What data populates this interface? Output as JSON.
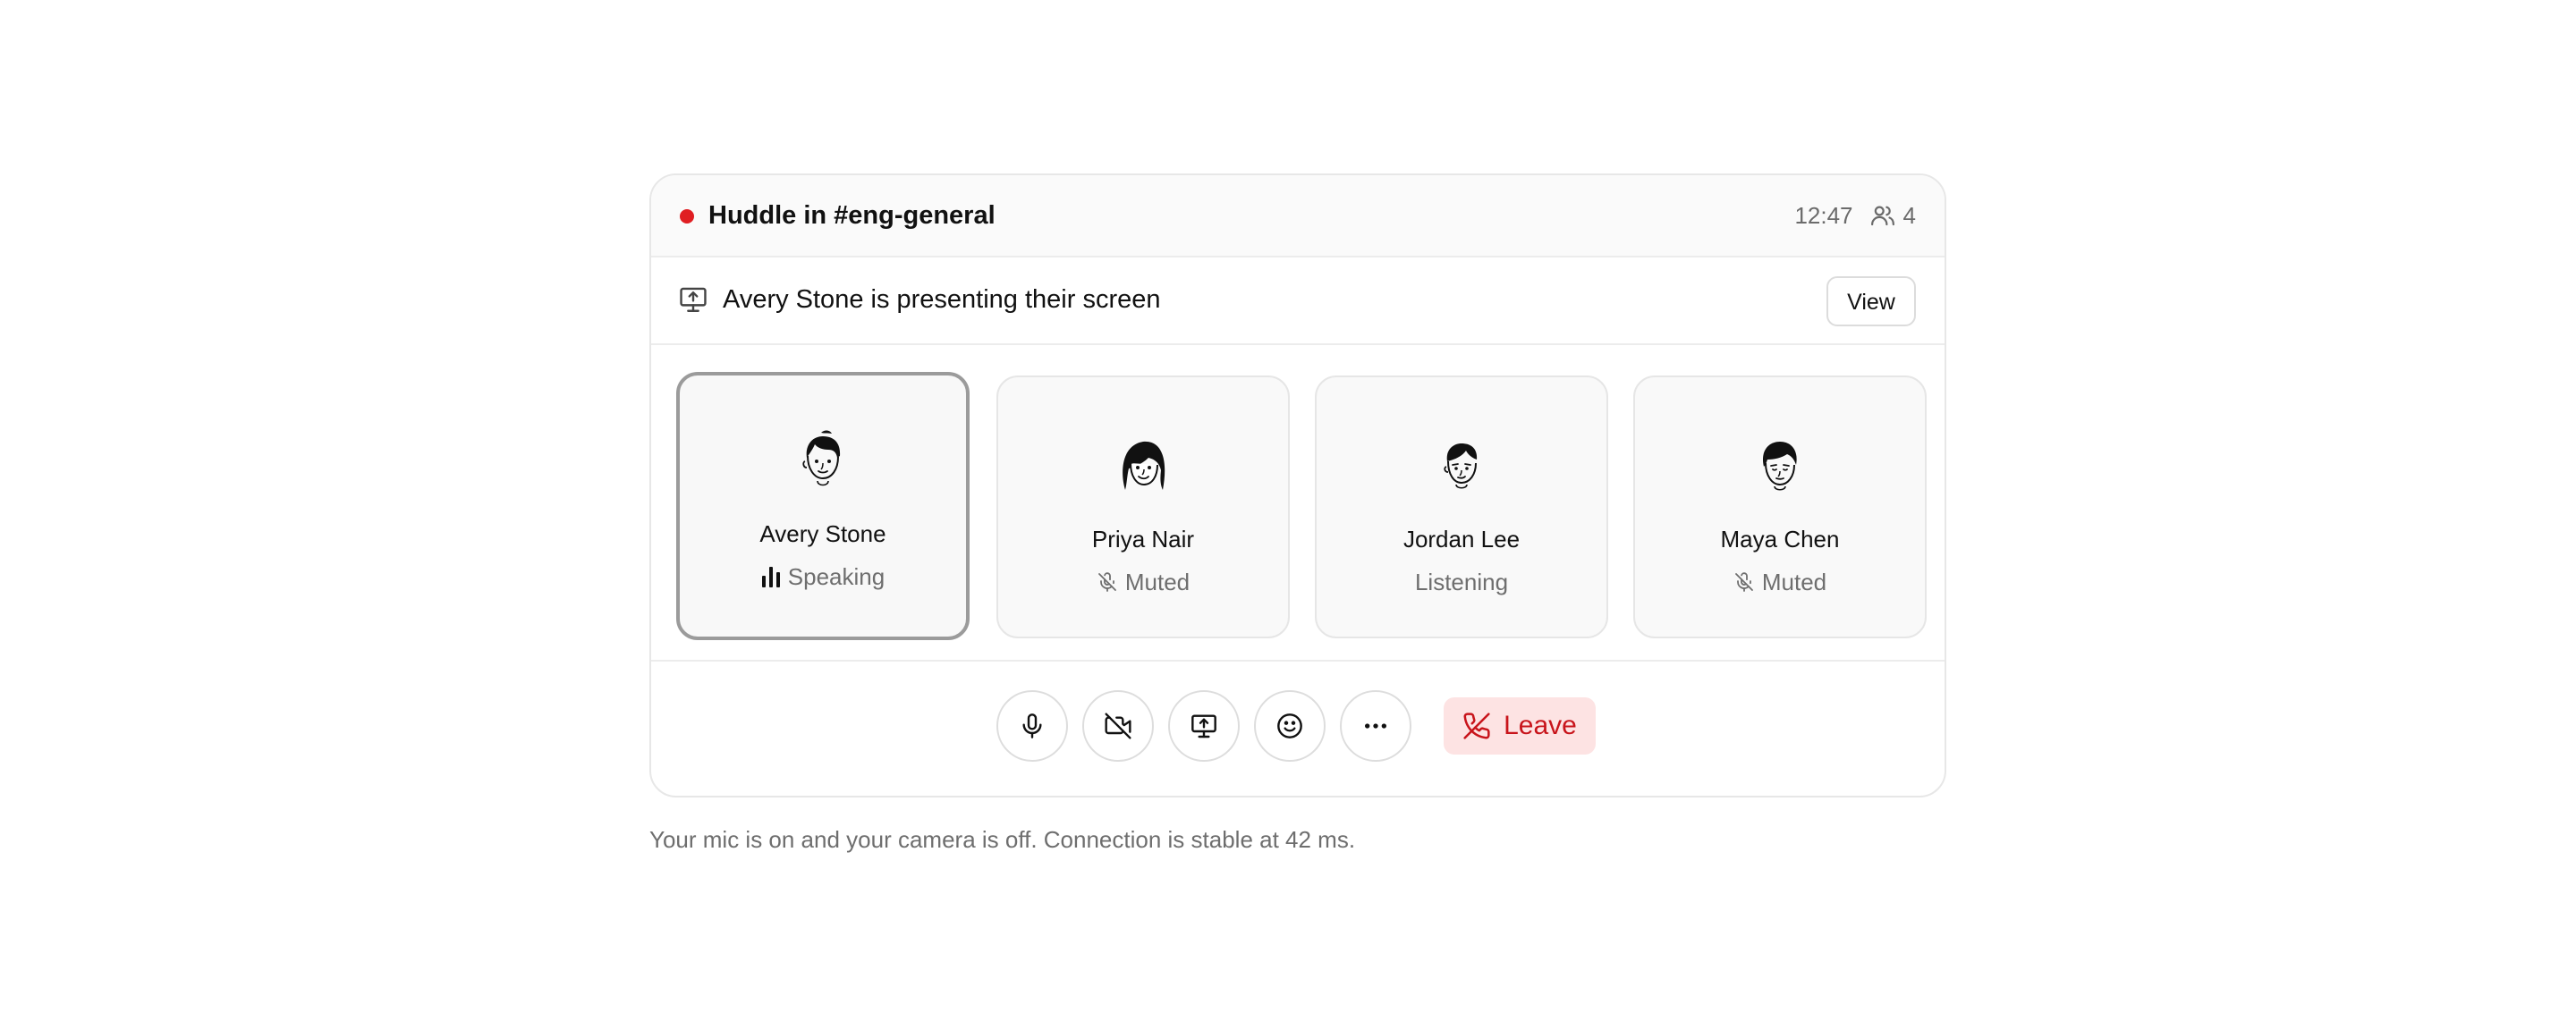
{
  "huddle": {
    "title": "Huddle in #eng-general",
    "elapsed": "12:47",
    "participant_count": "4",
    "live_color": "#e01e22"
  },
  "presenting": {
    "text": "Avery Stone is presenting their screen",
    "view_label": "View",
    "icon": "screen-share-icon"
  },
  "participants": [
    {
      "name": "Avery Stone",
      "status": "Speaking",
      "status_icon": "speaking-bars-icon",
      "active": true
    },
    {
      "name": "Priya Nair",
      "status": "Muted",
      "status_icon": "mic-off-icon",
      "active": false
    },
    {
      "name": "Jordan Lee",
      "status": "Listening",
      "status_icon": "",
      "active": false
    },
    {
      "name": "Maya Chen",
      "status": "Muted",
      "status_icon": "mic-off-icon",
      "active": false
    }
  ],
  "controls": {
    "buttons": [
      "mic-icon",
      "camera-off-icon",
      "share-screen-icon",
      "emoji-icon",
      "more-icon"
    ],
    "leave_label": "Leave",
    "leave_color": "#c8141b"
  },
  "footer": {
    "status_text": "Your mic is on and your camera is off. Connection is stable at 42 ms."
  }
}
